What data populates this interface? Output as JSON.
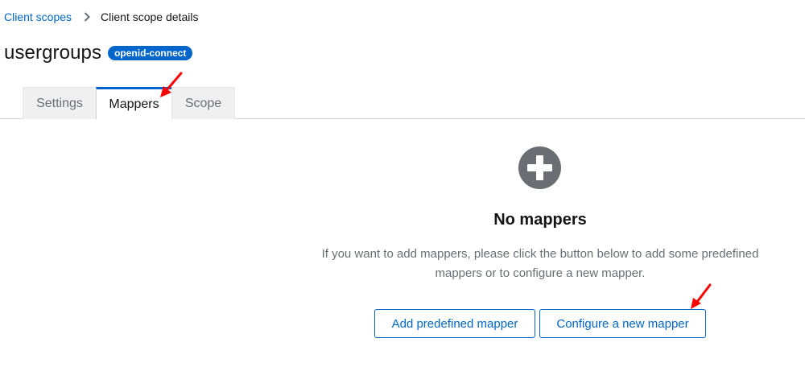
{
  "breadcrumb": {
    "parent": "Client scopes",
    "current": "Client scope details"
  },
  "header": {
    "title": "usergroups",
    "badge": "openid-connect"
  },
  "tabs": [
    {
      "label": "Settings",
      "active": false
    },
    {
      "label": "Mappers",
      "active": true
    },
    {
      "label": "Scope",
      "active": false
    }
  ],
  "empty_state": {
    "icon": "plus-circle-icon",
    "title": "No mappers",
    "body": "If you want to add mappers, please click the button below to add some predefined mappers or to configure a new mapper.",
    "buttons": {
      "add_predefined": "Add predefined mapper",
      "configure_new": "Configure a new mapper"
    }
  },
  "colors": {
    "link": "#0066cc",
    "badge_bg": "#0066cc",
    "icon": "#6a6e73",
    "annotation_arrow": "#ff0000"
  }
}
